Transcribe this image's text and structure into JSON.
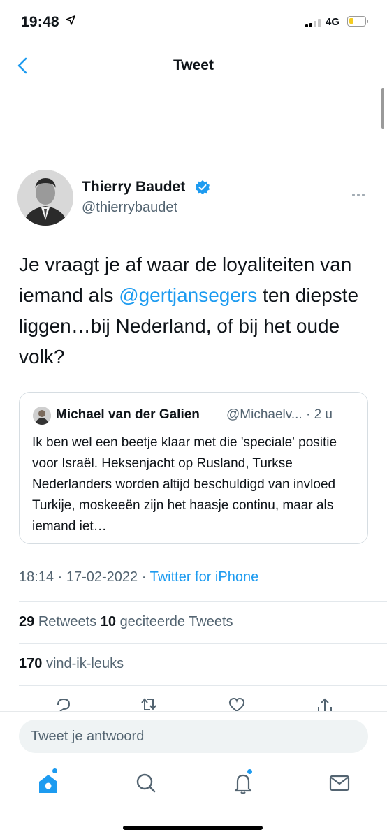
{
  "status_bar": {
    "time": "19:48",
    "network": "4G",
    "battery_level": 0.3
  },
  "nav": {
    "title": "Tweet"
  },
  "tweet": {
    "author_name": "Thierry Baudet",
    "handle": "@thierrybaudet",
    "text_part1": "Je vraagt je af waar de loyaliteiten van iemand als ",
    "mention": "@gertjansegers",
    "text_part2": " ten diepste liggen…bij Nederland, of bij het oude volk?",
    "quote": {
      "author_name": "Michael van der Galien",
      "handle_time": "@Michaelv... · 2 u",
      "text": "Ik ben wel een beetje klaar met die 'speciale' positie voor Israël. Heksenjacht op Rusland, Turkse Nederlanders worden altijd beschuldigd van invloed Turkije, moskeeën zijn het haasje continu, maar als iemand iet…"
    },
    "time": "18:14",
    "date": "17-02-2022",
    "source": "Twitter for iPhone",
    "retweets": "29",
    "retweets_label": "Retweets",
    "quotes": "10",
    "quotes_label": "geciteerde Tweets",
    "likes": "170",
    "likes_label": "vind-ik-leuks"
  },
  "composer": {
    "placeholder": "Tweet je antwoord"
  },
  "icons": {
    "back": "chevron-left-icon",
    "verified": "verified-badge-icon",
    "more": "more-horizontal-icon",
    "actions": [
      "reply-icon",
      "retweet-icon",
      "like-icon",
      "share-icon"
    ],
    "tabs": [
      "home-icon",
      "search-icon",
      "notifications-icon",
      "messages-icon"
    ]
  },
  "colors": {
    "accent": "#1d9bf0",
    "text": "#0f1419",
    "secondary": "#536471"
  }
}
